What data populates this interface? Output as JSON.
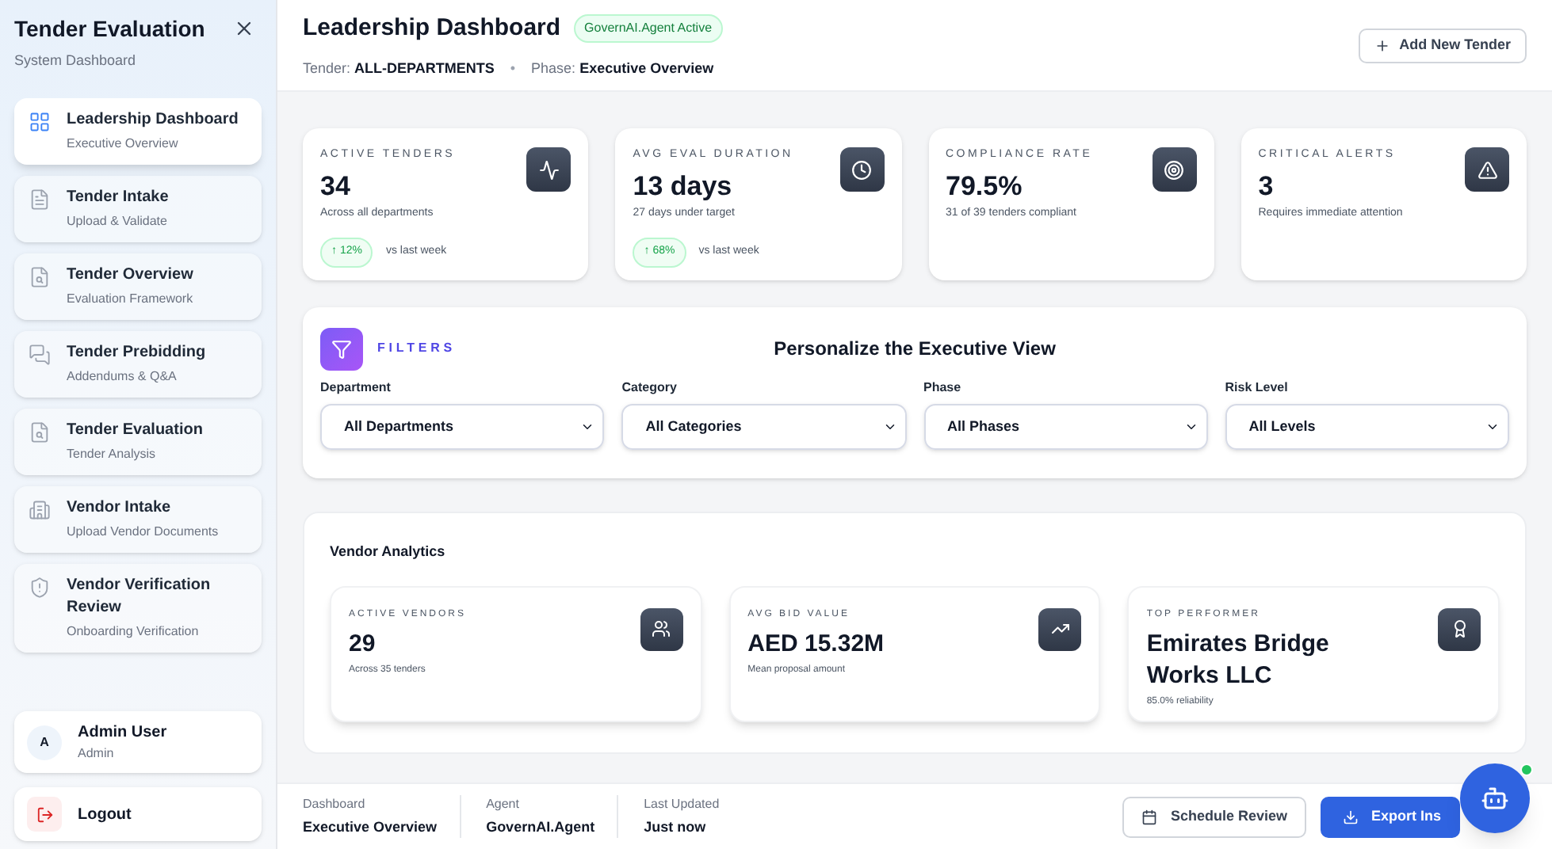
{
  "sidebar": {
    "title": "Tender Evaluation",
    "subtitle": "System Dashboard",
    "items": [
      {
        "label": "Leadership Dashboard",
        "sub": "Executive Overview",
        "selected": true
      },
      {
        "label": "Tender Intake",
        "sub": "Upload & Validate",
        "selected": false
      },
      {
        "label": "Tender Overview",
        "sub": "Evaluation Framework",
        "selected": false
      },
      {
        "label": "Tender Prebidding",
        "sub": "Addendums & Q&A",
        "selected": false
      },
      {
        "label": "Tender Evaluation",
        "sub": "Tender Analysis",
        "selected": false
      },
      {
        "label": "Vendor Intake",
        "sub": "Upload Vendor Documents",
        "selected": false
      },
      {
        "label": "Vendor Verification Review",
        "sub": "Onboarding Verification",
        "selected": false
      }
    ],
    "user": {
      "initial": "A",
      "name": "Admin User",
      "role": "Admin"
    },
    "logout": "Logout"
  },
  "header": {
    "title": "Leadership Dashboard",
    "badge": "GovernAI.Agent Active",
    "tender_label": "Tender:",
    "tender": "ALL-DEPARTMENTS",
    "separator": "•",
    "phase_label": "Phase:",
    "phase": "Executive Overview",
    "add_button": "Add New Tender"
  },
  "stats": [
    {
      "label": "ACTIVE TENDERS",
      "value": "34",
      "sub": "Across all departments",
      "trend": "↑ 12%",
      "trend_note": "vs last week"
    },
    {
      "label": "AVG EVAL DURATION",
      "value": "13 days",
      "sub": "27 days under target",
      "trend": "↑ 68%",
      "trend_note": "vs last week"
    },
    {
      "label": "COMPLIANCE RATE",
      "value": "79.5%",
      "sub": "31 of 39 tenders compliant"
    },
    {
      "label": "CRITICAL ALERTS",
      "value": "3",
      "sub": "Requires immediate attention"
    }
  ],
  "filters": {
    "label": "FILTERS",
    "title": "Personalize the Executive View",
    "fields": [
      {
        "label": "Department",
        "value": "All Departments"
      },
      {
        "label": "Category",
        "value": "All Categories"
      },
      {
        "label": "Phase",
        "value": "All Phases"
      },
      {
        "label": "Risk Level",
        "value": "All Levels"
      }
    ]
  },
  "vendor_analytics": {
    "title": "Vendor Analytics",
    "cards": [
      {
        "label": "ACTIVE VENDORS",
        "value": "29",
        "sub": "Across 35 tenders"
      },
      {
        "label": "AVG BID VALUE",
        "value": "AED 15.32M",
        "sub": "Mean proposal amount"
      },
      {
        "label": "TOP PERFORMER",
        "value": "Emirates Bridge Works LLC",
        "sub": "85.0% reliability"
      }
    ]
  },
  "footer": {
    "items": [
      {
        "label": "Dashboard",
        "value": "Executive Overview"
      },
      {
        "label": "Agent",
        "value": "GovernAI.Agent"
      },
      {
        "label": "Last Updated",
        "value": "Just now"
      }
    ],
    "schedule_button": "Schedule Review",
    "export_button": "Export Ins",
    "assistant_online": true
  }
}
